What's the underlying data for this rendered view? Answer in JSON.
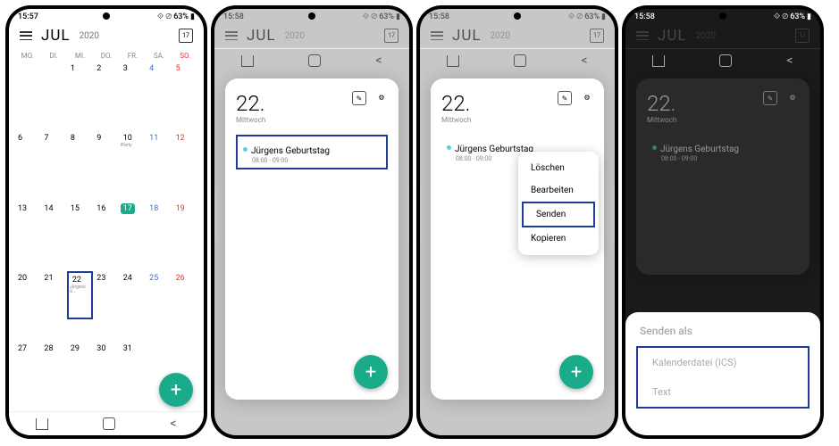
{
  "status": {
    "time1": "15:57",
    "time2": "15:58",
    "battery": "63%",
    "icons": "⟐ ⊘"
  },
  "header": {
    "month": "JUL",
    "year": "2020",
    "today_icon": "17"
  },
  "weekdays": [
    "MO.",
    "DI.",
    "MI.",
    "DO.",
    "FR.",
    "SA.",
    "SO."
  ],
  "days": [
    [
      "",
      "",
      "1",
      "2",
      "3",
      "4",
      "5"
    ],
    [
      "6",
      "7",
      "8",
      "9",
      "10",
      "11",
      "12"
    ],
    [
      "13",
      "14",
      "15",
      "16",
      "17",
      "18",
      "19"
    ],
    [
      "20",
      "21",
      "22",
      "23",
      "24",
      "25",
      "26"
    ],
    [
      "27",
      "28",
      "29",
      "30",
      "31",
      "",
      ""
    ]
  ],
  "event_preview": "Jürgens G...",
  "iparty": "iParty",
  "card": {
    "daynum": "22.",
    "dayname": "Mittwoch",
    "event_title": "Jürgens Geburtstag",
    "event_time": "08:00 - 09:00"
  },
  "ctx": {
    "loeschen": "Löschen",
    "bearbeiten": "Bearbeiten",
    "senden": "Senden",
    "kopieren": "Kopieren"
  },
  "sheet": {
    "title": "Senden als",
    "ics": "Kalenderdatei (ICS)",
    "text": "Text"
  },
  "fab": "+"
}
